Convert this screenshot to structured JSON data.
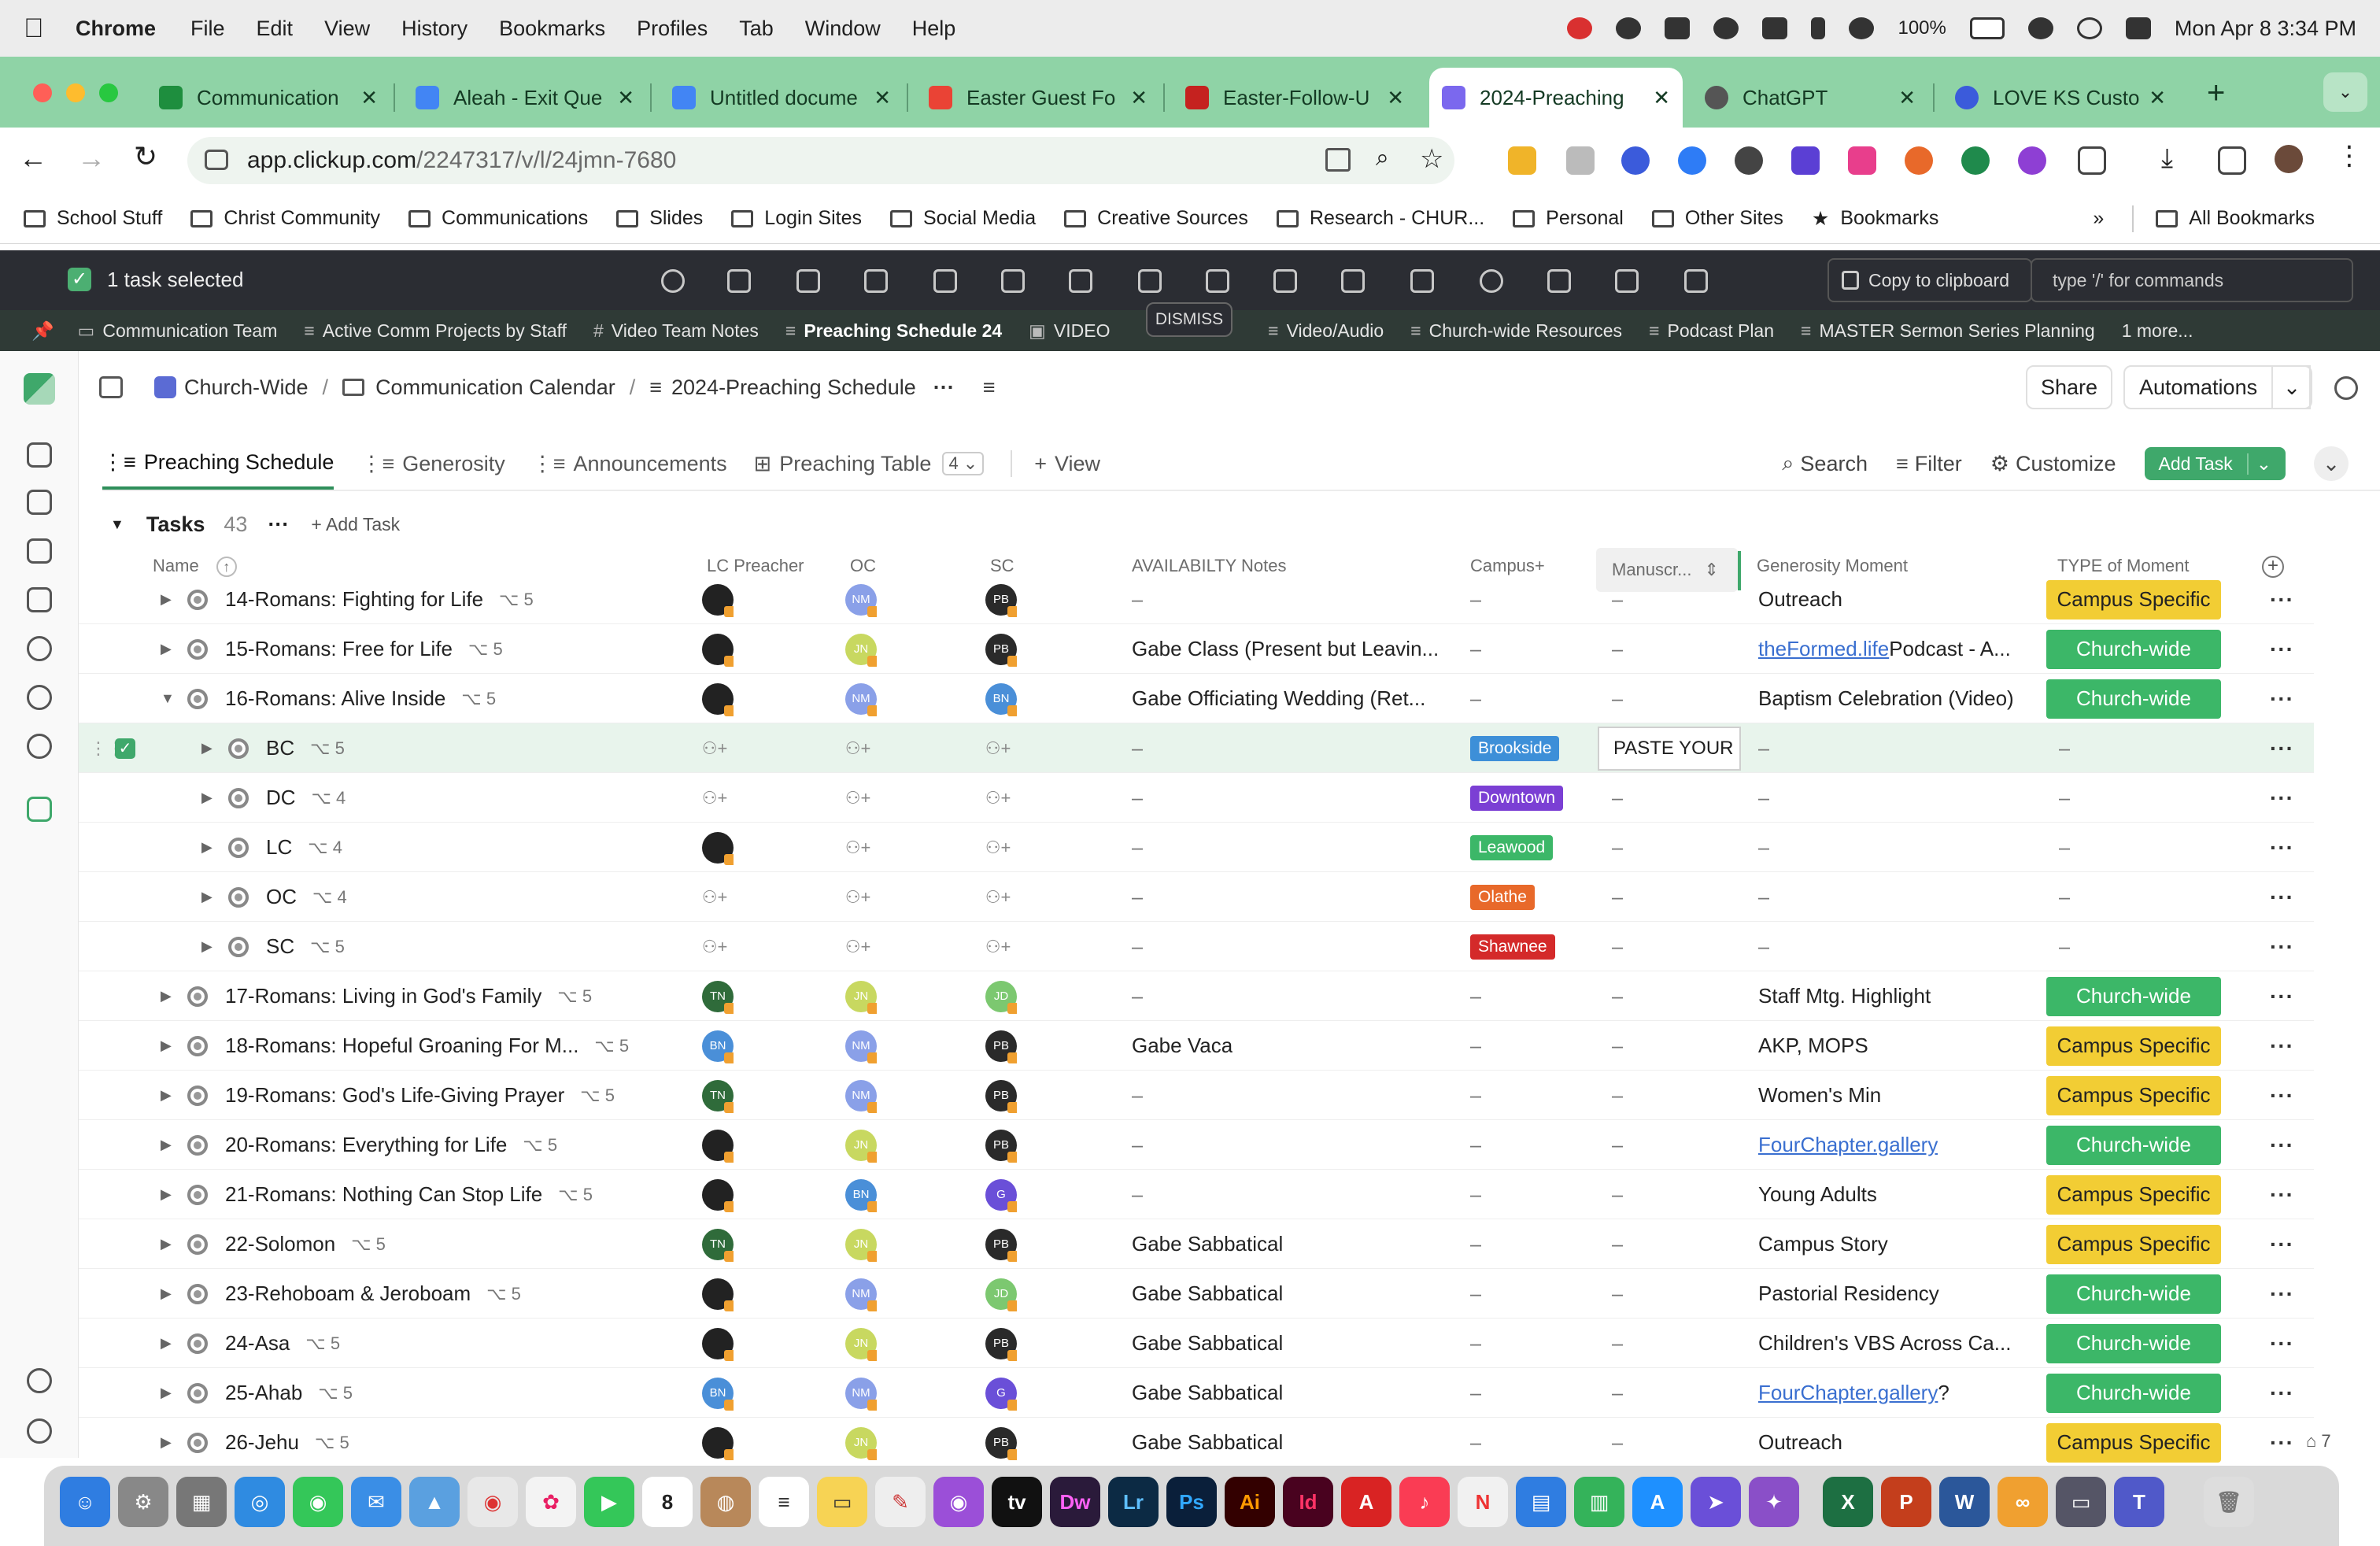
{
  "menubar": {
    "app": "Chrome",
    "items": [
      "File",
      "Edit",
      "View",
      "History",
      "Bookmarks",
      "Profiles",
      "Tab",
      "Window",
      "Help"
    ],
    "battery": "100%",
    "datetime": "Mon Apr 8  3:34 PM"
  },
  "tabs": [
    {
      "title": "Communication",
      "color": "#1e8e3e"
    },
    {
      "title": "Aleah - Exit Que",
      "color": "#4285f4"
    },
    {
      "title": "Untitled docume",
      "color": "#4285f4"
    },
    {
      "title": "Easter Guest Fo",
      "color": "#ea4335"
    },
    {
      "title": "Easter-Follow-U",
      "color": "#c5221f"
    },
    {
      "title": "2024-Preaching",
      "color": "#7b68ee"
    },
    {
      "title": "ChatGPT",
      "color": "#555555"
    },
    {
      "title": "LOVE KS Custon",
      "color": "#3b5bdb"
    }
  ],
  "url": {
    "host": "app.clickup.com",
    "path": "/2247317/v/l/24jmn-7680"
  },
  "bookmarks": [
    "School Stuff",
    "Christ Community",
    "Communications",
    "Slides",
    "Login Sites",
    "Social Media",
    "Creative Sources",
    "Research - CHUR...",
    "Personal",
    "Other Sites",
    "Bookmarks",
    "All Bookmarks"
  ],
  "selection": {
    "count_label": "1 task selected",
    "copy_label": "Copy to clipboard",
    "command_placeholder": "type '/' for commands"
  },
  "favorites": [
    "Communication Team",
    "Active Comm Projects by Staff",
    "Video Team Notes",
    "Preaching Schedule 24",
    "VIDEO",
    "Video/Audio",
    "Church-wide Resources",
    "Podcast Plan",
    "MASTER Sermon Series Planning",
    "1 more..."
  ],
  "dismiss_label": "DISMISS",
  "breadcrumb": {
    "space": "Church-Wide",
    "folder": "Communication Calendar",
    "list": "2024-Preaching Schedule"
  },
  "header_buttons": {
    "share": "Share",
    "automations": "Automations"
  },
  "views": [
    {
      "label": "Preaching Schedule",
      "active": true
    },
    {
      "label": "Generosity",
      "active": false
    },
    {
      "label": "Announcements",
      "active": false
    },
    {
      "label": "Preaching Table",
      "active": false
    }
  ],
  "views_extra": {
    "table_count": "4",
    "add_view": "View"
  },
  "view_actions": {
    "search": "Search",
    "filter": "Filter",
    "customize": "Customize",
    "add_task": "Add Task"
  },
  "group": {
    "name": "Tasks",
    "count": "43",
    "add": "Add Task"
  },
  "columns": {
    "name": "Name",
    "lc_preacher": "LC Preacher",
    "oc": "OC",
    "sc": "SC",
    "availability": "AVAILABILTY Notes",
    "campus": "Campus+",
    "manuscript": "Manuscr...",
    "generosity": "Generosity Moment",
    "type": "TYPE of Moment"
  },
  "rows": [
    {
      "name": "14-Romans: Fighting for Life",
      "sub": "5",
      "lc": "photo",
      "oc": "NM",
      "sc": "PB",
      "notes": "–",
      "campus": "–",
      "manu": "–",
      "gen": "Outreach",
      "type": "Campus Specific"
    },
    {
      "name": "15-Romans: Free for Life",
      "sub": "5",
      "lc": "photo",
      "oc": "JN",
      "sc": "PB",
      "notes": "Gabe Class (Present but Leavin...",
      "campus": "–",
      "manu": "–",
      "gen_link": "theFormed.life",
      "gen": " Podcast - A...",
      "type": "Church-wide"
    },
    {
      "name": "16-Romans: Alive Inside",
      "sub": "5",
      "lc": "photo",
      "oc": "NM",
      "sc": "BN",
      "notes": "Gabe Officiating Wedding (Ret...",
      "campus": "–",
      "manu": "–",
      "gen": "Baptism Celebration (Video)",
      "type": "Church-wide"
    },
    {
      "name": "BC",
      "sub": "5",
      "campus_badge": "Brookside",
      "manu_input": "PASTE YOUR"
    },
    {
      "name": "DC",
      "sub": "4",
      "campus_badge": "Downtown"
    },
    {
      "name": "LC",
      "sub": "4",
      "lc": "photo",
      "campus_badge": "Leawood"
    },
    {
      "name": "OC",
      "sub": "4",
      "campus_badge": "Olathe"
    },
    {
      "name": "SC",
      "sub": "5",
      "campus_badge": "Shawnee"
    },
    {
      "name": "17-Romans: Living in God's Family",
      "sub": "5",
      "lc": "TN",
      "oc": "JN",
      "sc": "JD",
      "notes": "–",
      "campus": "–",
      "manu": "–",
      "gen": "Staff Mtg. Highlight",
      "type": "Church-wide"
    },
    {
      "name": "18-Romans: Hopeful Groaning For M...",
      "sub": "5",
      "lc": "BN",
      "oc": "NM",
      "sc": "PB",
      "notes": "Gabe Vaca",
      "campus": "–",
      "manu": "–",
      "gen": "AKP, MOPS",
      "type": "Campus Specific"
    },
    {
      "name": "19-Romans: God's Life-Giving Prayer",
      "sub": "5",
      "lc": "TN",
      "oc": "NM",
      "sc": "PB",
      "notes": "–",
      "campus": "–",
      "manu": "–",
      "gen": "Women's Min",
      "type": "Campus Specific"
    },
    {
      "name": "20-Romans: Everything for Life",
      "sub": "5",
      "lc": "photo",
      "oc": "JN",
      "sc": "PB",
      "notes": "–",
      "campus": "–",
      "manu": "–",
      "gen_link": "FourChapter.gallery",
      "gen": "",
      "type": "Church-wide"
    },
    {
      "name": "21-Romans: Nothing Can Stop Life",
      "sub": "5",
      "lc": "photo",
      "oc": "BN",
      "sc": "G",
      "notes": "–",
      "campus": "–",
      "manu": "–",
      "gen": "Young Adults",
      "type": "Campus Specific"
    },
    {
      "name": "22-Solomon",
      "sub": "5",
      "lc": "TN",
      "oc": "JN",
      "sc": "PB",
      "notes": "Gabe Sabbatical",
      "campus": "–",
      "manu": "–",
      "gen": "Campus Story",
      "type": "Campus Specific"
    },
    {
      "name": "23-Rehoboam & Jeroboam",
      "sub": "5",
      "lc": "photo",
      "oc": "NM",
      "sc": "JD",
      "notes": "Gabe Sabbatical",
      "campus": "–",
      "manu": "–",
      "gen": "Pastorial Residency",
      "type": "Church-wide"
    },
    {
      "name": "24-Asa",
      "sub": "5",
      "lc": "photo",
      "oc": "JN",
      "sc": "PB",
      "notes": "Gabe Sabbatical",
      "campus": "–",
      "manu": "–",
      "gen": "Children's VBS Across Ca...",
      "type": "Church-wide"
    },
    {
      "name": "25-Ahab",
      "sub": "5",
      "lc": "BN",
      "oc": "NM",
      "sc": "G",
      "notes": "Gabe Sabbatical",
      "campus": "–",
      "manu": "–",
      "gen_link": "FourChapter.gallery",
      "gen": "?",
      "type": "Church-wide"
    },
    {
      "name": "26-Jehu",
      "sub": "5",
      "lc": "photo",
      "oc": "JN",
      "sc": "PB",
      "notes": "Gabe Sabbatical",
      "campus": "–",
      "manu": "–",
      "gen": "Outreach",
      "type": "Campus Specific"
    }
  ],
  "footer_count": "7",
  "colors": {
    "church_wide": "#3cb768",
    "campus_specific": "#f2cd34",
    "brookside": "#3d8fd8",
    "downtown": "#7b3fd4",
    "leawood": "#3cb768",
    "olathe": "#e8692a",
    "shawnee": "#d42a2a"
  }
}
